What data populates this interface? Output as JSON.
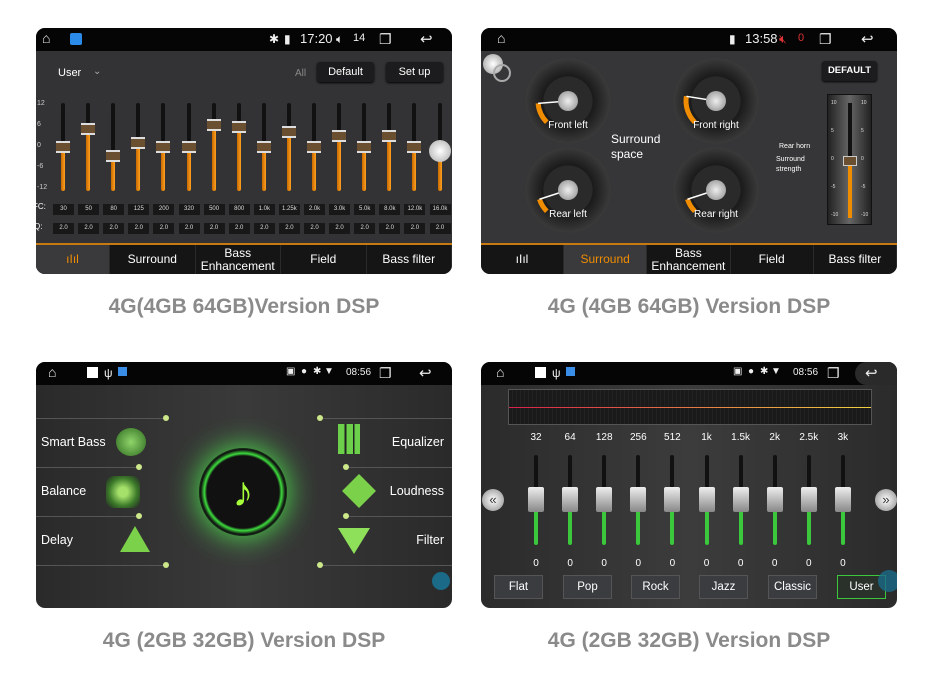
{
  "panels": [
    {
      "status": {
        "time": "17:20",
        "volume": "14"
      },
      "preset": "User",
      "all_label": "All",
      "default_label": "Default",
      "setup_label": "Set up",
      "scale": [
        "12",
        "6",
        "0",
        "-6",
        "-12"
      ],
      "fc_label": "FC:",
      "q_label": "Q:",
      "bands": [
        {
          "fc": "30",
          "q": "2.0",
          "gain": 0
        },
        {
          "fc": "50",
          "q": "2.0",
          "gain": 5
        },
        {
          "fc": "80",
          "q": "2.0",
          "gain": -2.5
        },
        {
          "fc": "125",
          "q": "2.0",
          "gain": 1
        },
        {
          "fc": "200",
          "q": "2.0",
          "gain": 0
        },
        {
          "fc": "320",
          "q": "2.0",
          "gain": 0
        },
        {
          "fc": "500",
          "q": "2.0",
          "gain": 6
        },
        {
          "fc": "800",
          "q": "2.0",
          "gain": 5.5
        },
        {
          "fc": "1.0k",
          "q": "2.0",
          "gain": 0
        },
        {
          "fc": "1.25k",
          "q": "2.0",
          "gain": 4
        },
        {
          "fc": "2.0k",
          "q": "2.0",
          "gain": 0
        },
        {
          "fc": "3.0k",
          "q": "2.0",
          "gain": 3
        },
        {
          "fc": "5.0k",
          "q": "2.0",
          "gain": 0
        },
        {
          "fc": "8.0k",
          "q": "2.0",
          "gain": 3
        },
        {
          "fc": "12.0k",
          "q": "2.0",
          "gain": 0
        },
        {
          "fc": "16.0k",
          "q": "2.0",
          "gain": -1
        }
      ],
      "tabs": [
        "Surround",
        "Bass Enhancement",
        "Field",
        "Bass filter"
      ],
      "active_tab": "equalizer",
      "caption": "4G(4GB 64GB)Version DSP"
    },
    {
      "status": {
        "time": "13:58",
        "volume": "0"
      },
      "default_label": "DEFAULT",
      "surround_space": "Surround space",
      "gauges": [
        {
          "label": "Front left",
          "value": 15
        },
        {
          "label": "Front right",
          "value": 20
        },
        {
          "label": "Rear left",
          "value": 10
        },
        {
          "label": "Rear right",
          "value": 10
        }
      ],
      "rear_horn": "Rear horn",
      "surround_strength": "Surround strength",
      "strength_scale": [
        "10",
        "5",
        "0",
        "-5",
        "-10"
      ],
      "strength_value": 0,
      "tabs": [
        "Surround",
        "Bass Enhancement",
        "Field",
        "Bass filter"
      ],
      "active_tab": "Surround",
      "caption": "4G (4GB 64GB) Version DSP"
    },
    {
      "status": {
        "time": "08:56"
      },
      "left_items": [
        "Smart Bass",
        "Balance",
        "Delay"
      ],
      "right_items": [
        "Equalizer",
        "Loudness",
        "Filter"
      ],
      "caption": "4G (2GB 32GB) Version DSP"
    },
    {
      "status": {
        "time": "08:56"
      },
      "bands": [
        {
          "freq": "32",
          "value": "0"
        },
        {
          "freq": "64",
          "value": "0"
        },
        {
          "freq": "128",
          "value": "0"
        },
        {
          "freq": "256",
          "value": "0"
        },
        {
          "freq": "512",
          "value": "0"
        },
        {
          "freq": "1k",
          "value": "0"
        },
        {
          "freq": "1.5k",
          "value": "0"
        },
        {
          "freq": "2k",
          "value": "0"
        },
        {
          "freq": "2.5k",
          "value": "0"
        },
        {
          "freq": "3k",
          "value": "0"
        }
      ],
      "presets": [
        "Flat",
        "Pop",
        "Rock",
        "Jazz",
        "Classic",
        "User"
      ],
      "active_preset": "User",
      "caption": "4G (2GB 32GB) Version DSP"
    }
  ],
  "colors": {
    "accent_orange": "#f08c00",
    "accent_green": "#3cc83c",
    "caption_gray": "#8a8a8a"
  }
}
